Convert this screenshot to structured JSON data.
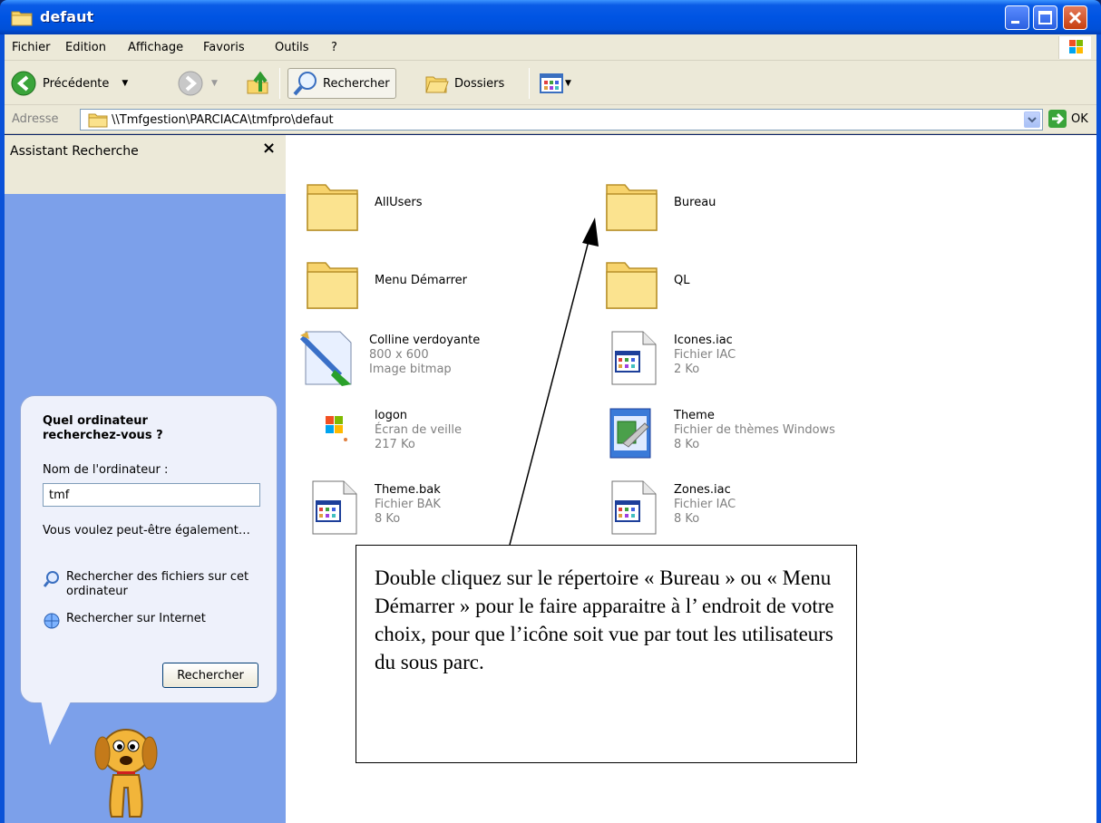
{
  "window": {
    "title": "defaut"
  },
  "menu": [
    "Fichier",
    "Edition",
    "Affichage",
    "Favoris",
    "Outils",
    "?"
  ],
  "toolbar": {
    "back_label": "Précédente",
    "search_label": "Rechercher",
    "folders_label": "Dossiers"
  },
  "address": {
    "label": "Adresse",
    "value": "\\\\Tmfgestion\\PARCIACA\\tmfpro\\defaut",
    "go_label": "OK"
  },
  "left_pane": {
    "title": "Assistant Recherche",
    "close": "×",
    "question": "Quel ordinateur recherchez-vous ?",
    "computer_label": "Nom de l'ordinateur :",
    "computer_value": "tmf",
    "maybe": "Vous voulez peut-être également…",
    "link_files": "Rechercher des fichiers sur cet ordinateur",
    "link_internet": "Rechercher sur Internet",
    "search_button": "Rechercher"
  },
  "items": [
    {
      "name": "AllUsers",
      "icon": "folder-icon"
    },
    {
      "name": "Bureau",
      "icon": "folder-icon"
    },
    {
      "name": "Menu Démarrer",
      "icon": "folder-icon"
    },
    {
      "name": "QL",
      "icon": "folder-icon"
    },
    {
      "name": "Colline verdoyante",
      "line2": "800 x 600",
      "line3": "Image bitmap",
      "icon": "bitmap-icon"
    },
    {
      "name": "Icones.iac",
      "line2": "Fichier IAC",
      "line3": "2 Ko",
      "icon": "document-icon"
    },
    {
      "name": "logon",
      "line2": "Écran de veille",
      "line3": "217 Ko",
      "icon": "screensaver-icon"
    },
    {
      "name": "Theme",
      "line2": "Fichier de thèmes Windows",
      "line3": "8 Ko",
      "icon": "theme-icon"
    },
    {
      "name": "Theme.bak",
      "line2": "Fichier BAK",
      "line3": "8 Ko",
      "icon": "document-icon"
    },
    {
      "name": "Zones.iac",
      "line2": "Fichier IAC",
      "line3": "8 Ko",
      "icon": "document-icon"
    }
  ],
  "callout": {
    "text": "Double cliquez sur le répertoire « Bureau » ou « Menu Démarrer » pour le faire apparaitre à l’ endroit de votre choix, pour que l’icône soit vue par tout les utilisateurs du sous parc."
  },
  "colors": {
    "titlebar": "#0054e3",
    "task_pane": "#7ca0ea",
    "chrome": "#ece9d8"
  }
}
